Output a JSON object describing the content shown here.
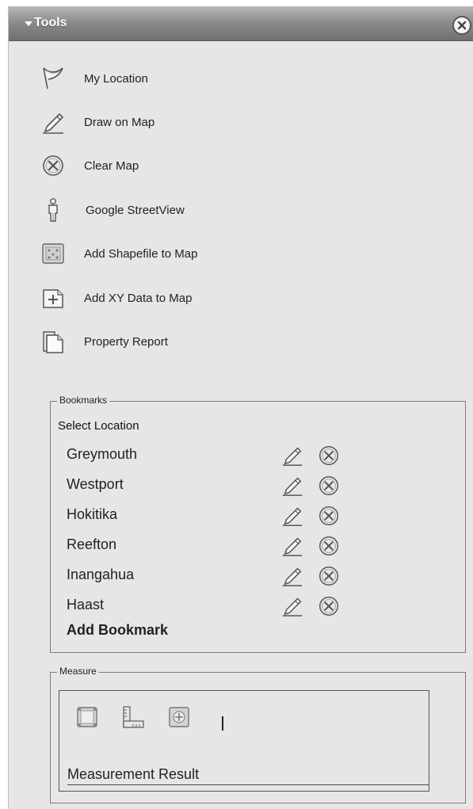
{
  "header": {
    "title": "Tools"
  },
  "tools": [
    {
      "label": "My Location",
      "icon": "flag-icon"
    },
    {
      "label": "Draw on Map",
      "icon": "pencil-icon"
    },
    {
      "label": "Clear Map",
      "icon": "clear-circle-icon"
    },
    {
      "label": "Google StreetView",
      "icon": "person-icon"
    },
    {
      "label": "Add Shapefile to Map",
      "icon": "shapefile-icon"
    },
    {
      "label": "Add XY Data to Map",
      "icon": "add-data-icon"
    },
    {
      "label": "Property Report",
      "icon": "document-icon"
    }
  ],
  "bookmarks": {
    "legend": "Bookmarks",
    "select_label": "Select Location",
    "items": [
      "Greymouth",
      "Westport",
      "Hokitika",
      "Reefton",
      "Inangahua",
      "Haast"
    ],
    "add_label": "Add Bookmark"
  },
  "measure": {
    "legend": "Measure",
    "result_label": "Measurement Result"
  }
}
